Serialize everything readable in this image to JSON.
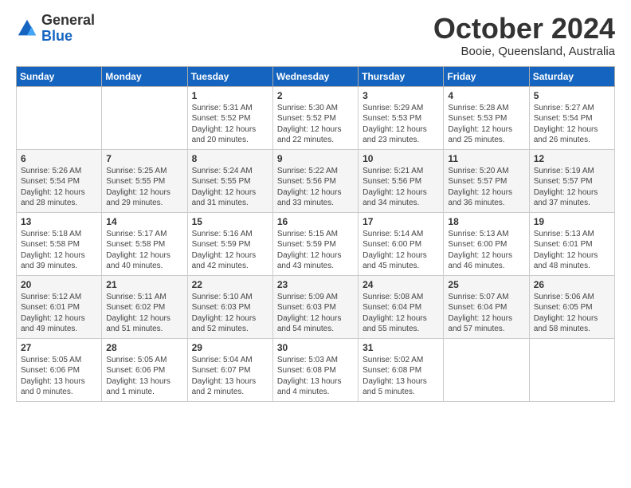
{
  "logo": {
    "general": "General",
    "blue": "Blue"
  },
  "header": {
    "month": "October 2024",
    "location": "Booie, Queensland, Australia"
  },
  "days_of_week": [
    "Sunday",
    "Monday",
    "Tuesday",
    "Wednesday",
    "Thursday",
    "Friday",
    "Saturday"
  ],
  "weeks": [
    [
      {
        "day": "",
        "info": ""
      },
      {
        "day": "",
        "info": ""
      },
      {
        "day": "1",
        "info": "Sunrise: 5:31 AM\nSunset: 5:52 PM\nDaylight: 12 hours\nand 20 minutes."
      },
      {
        "day": "2",
        "info": "Sunrise: 5:30 AM\nSunset: 5:52 PM\nDaylight: 12 hours\nand 22 minutes."
      },
      {
        "day": "3",
        "info": "Sunrise: 5:29 AM\nSunset: 5:53 PM\nDaylight: 12 hours\nand 23 minutes."
      },
      {
        "day": "4",
        "info": "Sunrise: 5:28 AM\nSunset: 5:53 PM\nDaylight: 12 hours\nand 25 minutes."
      },
      {
        "day": "5",
        "info": "Sunrise: 5:27 AM\nSunset: 5:54 PM\nDaylight: 12 hours\nand 26 minutes."
      }
    ],
    [
      {
        "day": "6",
        "info": "Sunrise: 5:26 AM\nSunset: 5:54 PM\nDaylight: 12 hours\nand 28 minutes."
      },
      {
        "day": "7",
        "info": "Sunrise: 5:25 AM\nSunset: 5:55 PM\nDaylight: 12 hours\nand 29 minutes."
      },
      {
        "day": "8",
        "info": "Sunrise: 5:24 AM\nSunset: 5:55 PM\nDaylight: 12 hours\nand 31 minutes."
      },
      {
        "day": "9",
        "info": "Sunrise: 5:22 AM\nSunset: 5:56 PM\nDaylight: 12 hours\nand 33 minutes."
      },
      {
        "day": "10",
        "info": "Sunrise: 5:21 AM\nSunset: 5:56 PM\nDaylight: 12 hours\nand 34 minutes."
      },
      {
        "day": "11",
        "info": "Sunrise: 5:20 AM\nSunset: 5:57 PM\nDaylight: 12 hours\nand 36 minutes."
      },
      {
        "day": "12",
        "info": "Sunrise: 5:19 AM\nSunset: 5:57 PM\nDaylight: 12 hours\nand 37 minutes."
      }
    ],
    [
      {
        "day": "13",
        "info": "Sunrise: 5:18 AM\nSunset: 5:58 PM\nDaylight: 12 hours\nand 39 minutes."
      },
      {
        "day": "14",
        "info": "Sunrise: 5:17 AM\nSunset: 5:58 PM\nDaylight: 12 hours\nand 40 minutes."
      },
      {
        "day": "15",
        "info": "Sunrise: 5:16 AM\nSunset: 5:59 PM\nDaylight: 12 hours\nand 42 minutes."
      },
      {
        "day": "16",
        "info": "Sunrise: 5:15 AM\nSunset: 5:59 PM\nDaylight: 12 hours\nand 43 minutes."
      },
      {
        "day": "17",
        "info": "Sunrise: 5:14 AM\nSunset: 6:00 PM\nDaylight: 12 hours\nand 45 minutes."
      },
      {
        "day": "18",
        "info": "Sunrise: 5:13 AM\nSunset: 6:00 PM\nDaylight: 12 hours\nand 46 minutes."
      },
      {
        "day": "19",
        "info": "Sunrise: 5:13 AM\nSunset: 6:01 PM\nDaylight: 12 hours\nand 48 minutes."
      }
    ],
    [
      {
        "day": "20",
        "info": "Sunrise: 5:12 AM\nSunset: 6:01 PM\nDaylight: 12 hours\nand 49 minutes."
      },
      {
        "day": "21",
        "info": "Sunrise: 5:11 AM\nSunset: 6:02 PM\nDaylight: 12 hours\nand 51 minutes."
      },
      {
        "day": "22",
        "info": "Sunrise: 5:10 AM\nSunset: 6:03 PM\nDaylight: 12 hours\nand 52 minutes."
      },
      {
        "day": "23",
        "info": "Sunrise: 5:09 AM\nSunset: 6:03 PM\nDaylight: 12 hours\nand 54 minutes."
      },
      {
        "day": "24",
        "info": "Sunrise: 5:08 AM\nSunset: 6:04 PM\nDaylight: 12 hours\nand 55 minutes."
      },
      {
        "day": "25",
        "info": "Sunrise: 5:07 AM\nSunset: 6:04 PM\nDaylight: 12 hours\nand 57 minutes."
      },
      {
        "day": "26",
        "info": "Sunrise: 5:06 AM\nSunset: 6:05 PM\nDaylight: 12 hours\nand 58 minutes."
      }
    ],
    [
      {
        "day": "27",
        "info": "Sunrise: 5:05 AM\nSunset: 6:06 PM\nDaylight: 13 hours\nand 0 minutes."
      },
      {
        "day": "28",
        "info": "Sunrise: 5:05 AM\nSunset: 6:06 PM\nDaylight: 13 hours\nand 1 minute."
      },
      {
        "day": "29",
        "info": "Sunrise: 5:04 AM\nSunset: 6:07 PM\nDaylight: 13 hours\nand 2 minutes."
      },
      {
        "day": "30",
        "info": "Sunrise: 5:03 AM\nSunset: 6:08 PM\nDaylight: 13 hours\nand 4 minutes."
      },
      {
        "day": "31",
        "info": "Sunrise: 5:02 AM\nSunset: 6:08 PM\nDaylight: 13 hours\nand 5 minutes."
      },
      {
        "day": "",
        "info": ""
      },
      {
        "day": "",
        "info": ""
      }
    ]
  ]
}
